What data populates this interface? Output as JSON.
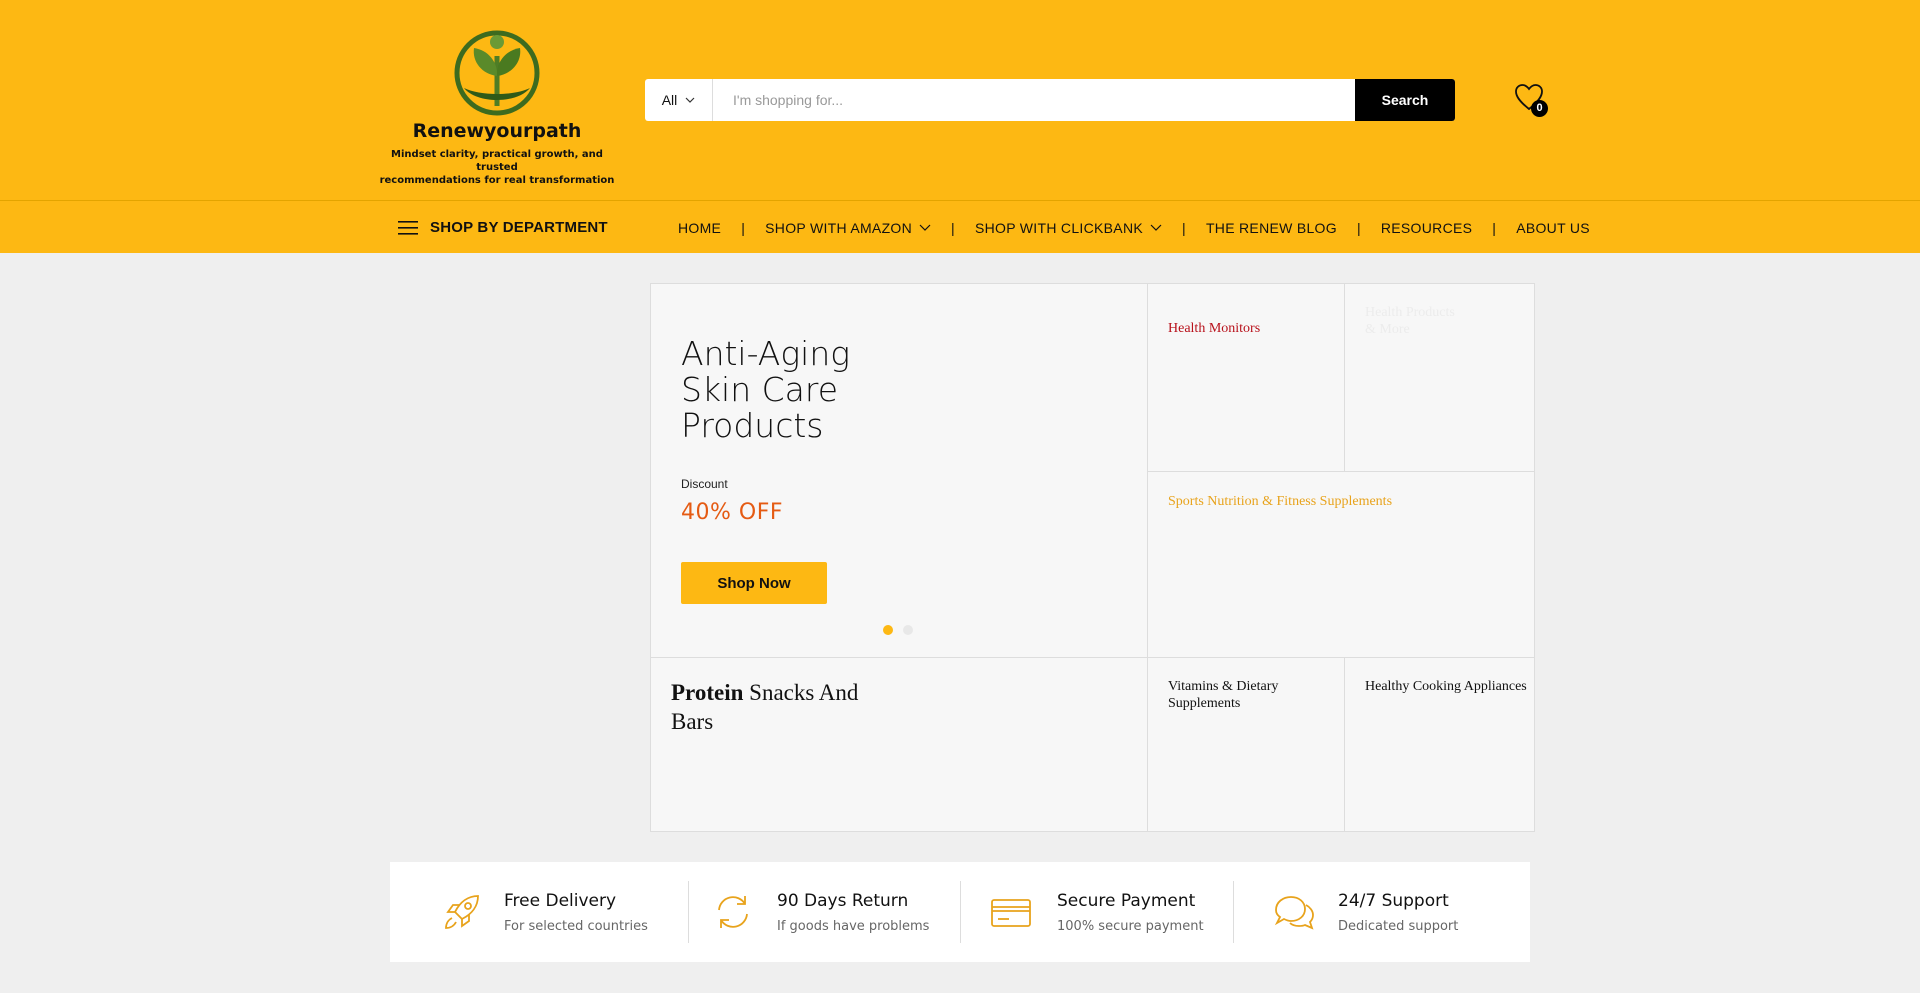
{
  "brand": {
    "name": "Renewyourpath",
    "tagline_line1": "Mindset clarity, practical growth, and trusted",
    "tagline_line2": "recommendations for real transformation"
  },
  "search": {
    "category": "All",
    "placeholder": "I'm shopping for...",
    "button": "Search"
  },
  "wishlist": {
    "count": "0"
  },
  "nav": {
    "department": "SHOP BY DEPARTMENT",
    "items": [
      {
        "label": "HOME"
      },
      {
        "label": "SHOP WITH AMAZON"
      },
      {
        "label": "SHOP WITH CLICKBANK"
      },
      {
        "label": "THE RENEW BLOG"
      },
      {
        "label": "RESOURCES"
      },
      {
        "label": "ABOUT US"
      }
    ],
    "separator": "|"
  },
  "hero": {
    "title_line1": "Anti-Aging",
    "title_line2": "Skin Care",
    "title_line3": "Products",
    "discount_label": "Discount",
    "discount_value": "40% OFF",
    "button": "Shop Now"
  },
  "categories": {
    "health_monitors": "Health Monitors",
    "faded_line1": "Health Products",
    "faded_line2": "& More",
    "sports": "Sports Nutrition & Fitness Supplements",
    "protein_bold": "Protein",
    "protein_rest": " Snacks And Bars",
    "vitamins": "Vitamins & Dietary Supplements",
    "cooking": "Healthy Cooking Appliances"
  },
  "features": [
    {
      "title": "Free Delivery",
      "subtitle": "For selected countries",
      "icon": "rocket-icon"
    },
    {
      "title": "90 Days Return",
      "subtitle": "If goods have problems",
      "icon": "return-arrows-icon"
    },
    {
      "title": "Secure Payment",
      "subtitle": "100% secure payment",
      "icon": "credit-card-icon"
    },
    {
      "title": "24/7 Support",
      "subtitle": "Dedicated support",
      "icon": "chat-bubbles-icon"
    }
  ],
  "colors": {
    "brand_yellow": "#fdb813",
    "discount_orange": "#e55b13",
    "health_red": "#b8111b",
    "sports_gold": "#e8a31c"
  }
}
